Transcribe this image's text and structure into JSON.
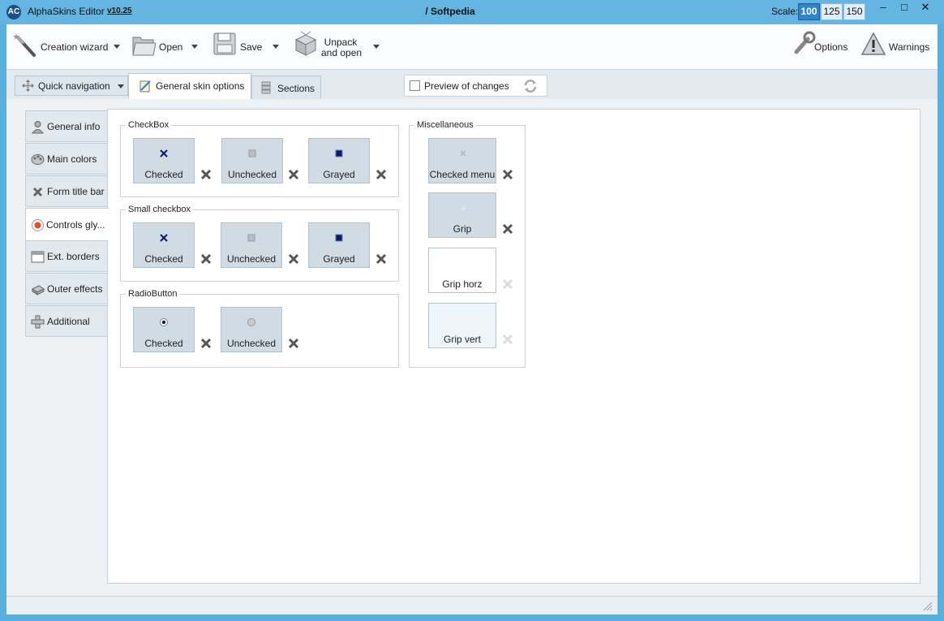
{
  "app": {
    "name": "AlphaSkins Editor",
    "version": "v10.25",
    "logo": "AC",
    "window_title": "/ Softpedia"
  },
  "scale": {
    "label": "Scale:",
    "options": [
      "100",
      "125",
      "150"
    ],
    "selected": "100"
  },
  "window_controls": {
    "minimize": "–",
    "maximize": "□",
    "close": "✕"
  },
  "toolbar": {
    "creation_wizard": "Creation wizard",
    "open": "Open",
    "save": "Save",
    "unpack_line1": "Unpack",
    "unpack_line2": "and open",
    "options": "Options",
    "warnings": "Warnings"
  },
  "tabs": {
    "quick_nav": "Quick navigation",
    "general_skin": "General  skin options",
    "sections": "Sections",
    "preview": "Preview of changes",
    "preview_checked": false
  },
  "sidebar": {
    "items": [
      {
        "label": "General info",
        "icon": "user-icon"
      },
      {
        "label": "Main colors",
        "icon": "palette-icon"
      },
      {
        "label": "Form title bar",
        "icon": "close-icon"
      },
      {
        "label": "Controls gly...",
        "icon": "radio-icon"
      },
      {
        "label": "Ext. borders",
        "icon": "window-icon"
      },
      {
        "label": "Outer effects",
        "icon": "shadow-icon"
      },
      {
        "label": "Additional",
        "icon": "plus-icon"
      }
    ],
    "active_index": 3
  },
  "groups": {
    "checkbox": {
      "title": "CheckBox",
      "items": [
        "Checked",
        "Unchecked",
        "Grayed"
      ]
    },
    "small_checkbox": {
      "title": "Small checkbox",
      "items": [
        "Checked",
        "Unchecked",
        "Grayed"
      ]
    },
    "radio": {
      "title": "RadioButton",
      "items": [
        "Checked",
        "Unchecked"
      ]
    },
    "misc": {
      "title": "Miscellaneous",
      "items": [
        "Checked menu",
        "Grip",
        "Grip horz",
        "Grip vert"
      ]
    }
  },
  "colors": {
    "titlebar": "#65b5e2",
    "accent": "#2f85c8",
    "glyph_dark": "#0a1a6e"
  }
}
